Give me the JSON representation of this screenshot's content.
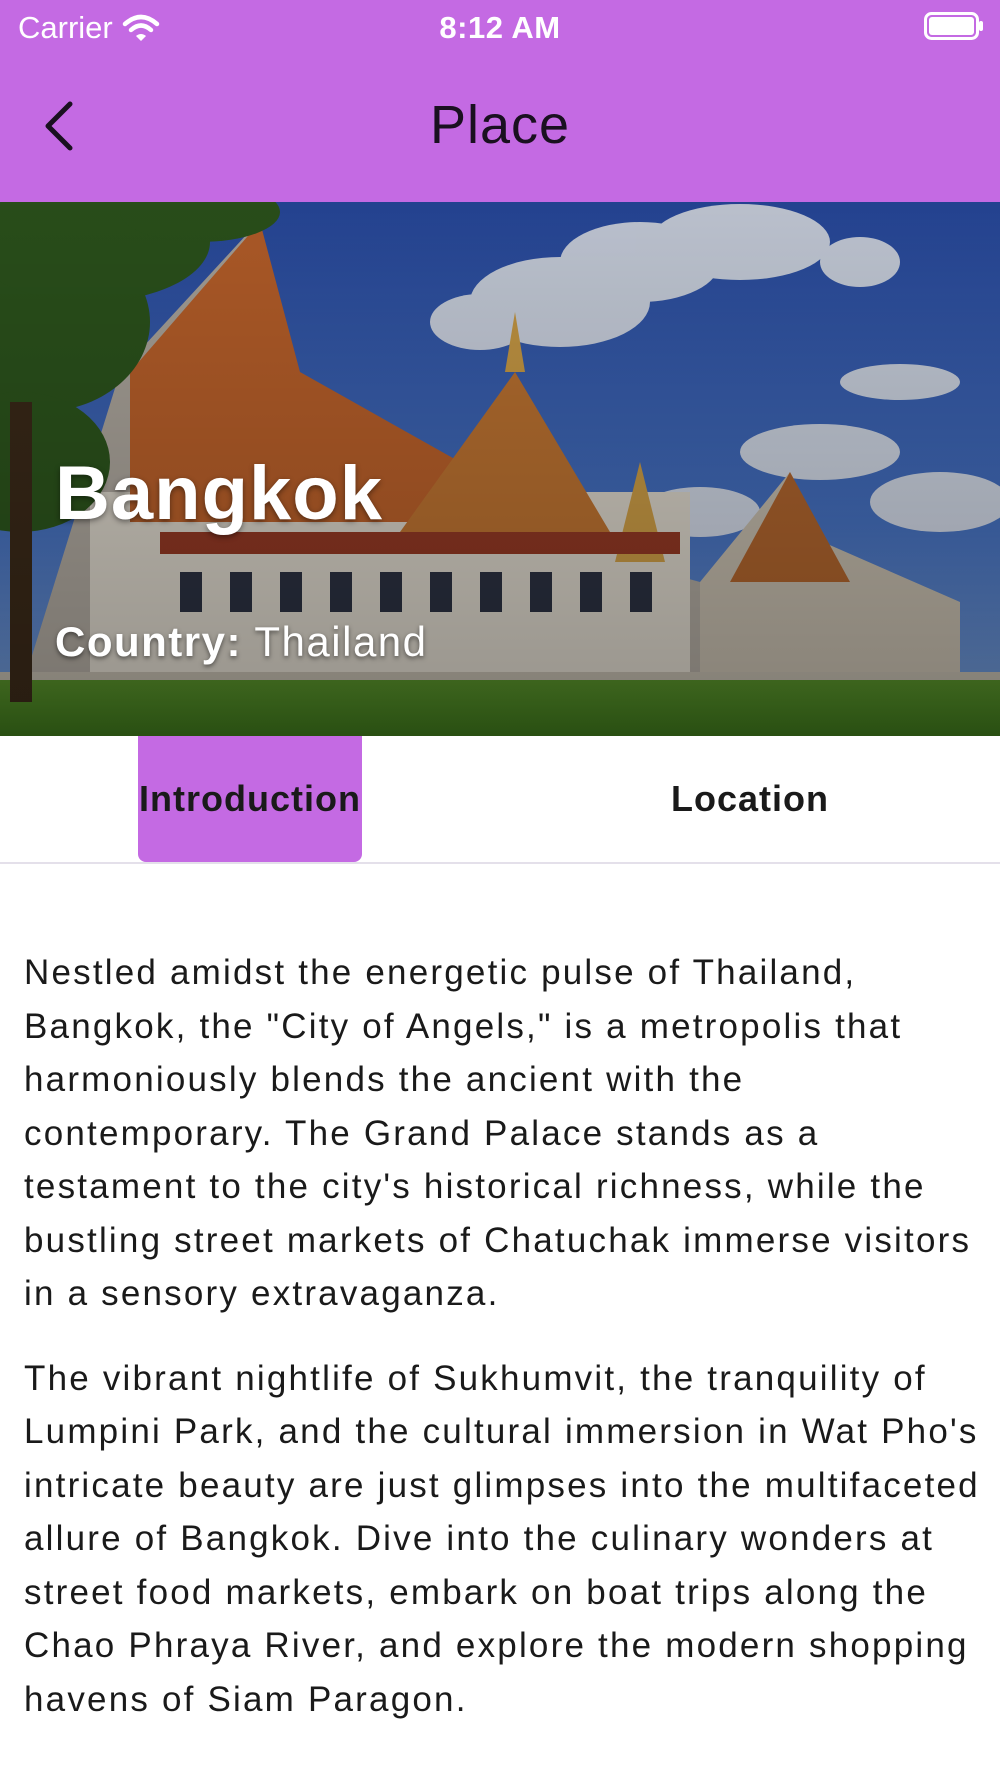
{
  "status_bar": {
    "carrier": "Carrier",
    "time": "8:12 AM",
    "icons": [
      "wifi-icon",
      "battery-icon"
    ]
  },
  "nav": {
    "title": "Place",
    "back_icon": "chevron-left-icon"
  },
  "place": {
    "name": "Bangkok",
    "country_label": "Country:",
    "country": "Thailand"
  },
  "tabs": [
    {
      "label": "Introduction",
      "selected": true
    },
    {
      "label": "Location",
      "selected": false
    }
  ],
  "intro": {
    "paragraphs": [
      "Nestled amidst the energetic pulse of Thailand, Bangkok, the \"City of Angels,\" is a metropolis that harmoniously blends the ancient with the contemporary. The Grand Palace stands as a testament to the city's historical richness, while the bustling street markets of Chatuchak immerse visitors in a sensory extravaganza.",
      "The vibrant nightlife of Sukhumvit, the tranquility of Lumpini Park, and the cultural immersion in Wat Pho's intricate beauty are just glimpses into the multifaceted allure of Bangkok. Dive into the culinary wonders at street food markets, embark on boat trips along the Chao Phraya River, and explore the modern shopping havens of Siam Paragon."
    ]
  },
  "colors": {
    "accent": "#c46ae3",
    "text": "#1a1a1a",
    "on_accent": "#ffffff"
  }
}
